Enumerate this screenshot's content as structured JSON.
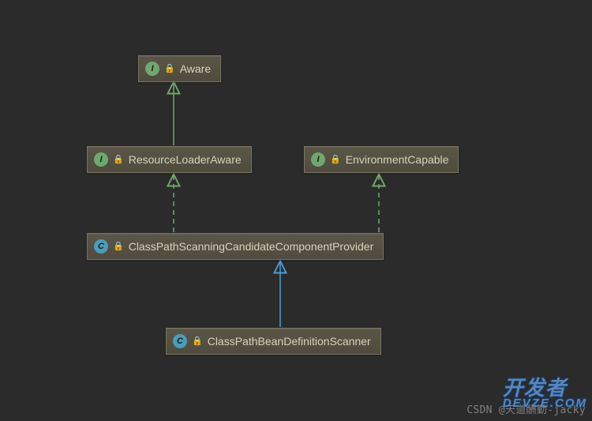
{
  "nodes": {
    "aware": {
      "type": "I",
      "label": "Aware"
    },
    "resourceLoaderAware": {
      "type": "I",
      "label": "ResourceLoaderAware"
    },
    "environmentCapable": {
      "type": "I",
      "label": "EnvironmentCapable"
    },
    "cpsccp": {
      "type": "C",
      "label": "ClassPathScanningCandidateComponentProvider"
    },
    "cpbds": {
      "type": "C",
      "label": "ClassPathBeanDefinitionScanner"
    }
  },
  "watermarks": {
    "csdn": "CSDN @天道酬勤-jacky",
    "brand_top": "开发者",
    "brand_bottom": "DEVZE.COM"
  },
  "chart_data": {
    "type": "diagram",
    "subtype": "uml-class-hierarchy",
    "nodes": [
      {
        "id": "Aware",
        "kind": "interface"
      },
      {
        "id": "ResourceLoaderAware",
        "kind": "interface"
      },
      {
        "id": "EnvironmentCapable",
        "kind": "interface"
      },
      {
        "id": "ClassPathScanningCandidateComponentProvider",
        "kind": "class"
      },
      {
        "id": "ClassPathBeanDefinitionScanner",
        "kind": "class"
      }
    ],
    "edges": [
      {
        "from": "ResourceLoaderAware",
        "to": "Aware",
        "relation": "extends",
        "style": "solid"
      },
      {
        "from": "ClassPathScanningCandidateComponentProvider",
        "to": "ResourceLoaderAware",
        "relation": "implements",
        "style": "dashed"
      },
      {
        "from": "ClassPathScanningCandidateComponentProvider",
        "to": "EnvironmentCapable",
        "relation": "implements",
        "style": "dashed"
      },
      {
        "from": "ClassPathBeanDefinitionScanner",
        "to": "ClassPathScanningCandidateComponentProvider",
        "relation": "extends",
        "style": "solid"
      }
    ]
  }
}
